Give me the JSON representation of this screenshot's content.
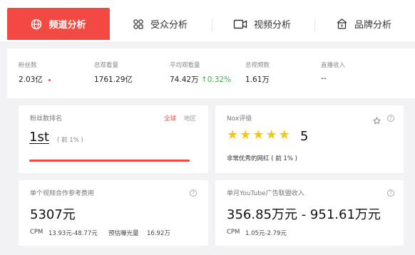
{
  "tabs": [
    {
      "label": "频道分析",
      "icon": "globe-icon",
      "active": true
    },
    {
      "label": "受众分析",
      "icon": "audience-icon",
      "active": false
    },
    {
      "label": "视频分析",
      "icon": "video-icon",
      "active": false
    },
    {
      "label": "品牌分析",
      "icon": "brand-icon",
      "active": false
    }
  ],
  "stats": {
    "subscribers": {
      "label": "粉丝数",
      "value": "2.03亿"
    },
    "total_views": {
      "label": "总观看量",
      "value": "1761.29亿"
    },
    "avg_views": {
      "label": "平均观看量",
      "value": "74.42万",
      "change": "0.32%"
    },
    "total_videos": {
      "label": "总视频数",
      "value": "1.61万"
    },
    "live_income": {
      "label": "直播收入",
      "value": "--"
    }
  },
  "rank_card": {
    "title": "粉丝数排名",
    "filter_global": "全球",
    "filter_region": "地区",
    "rank": "1st",
    "percent": "( 前 1% )",
    "accent_color": "#f24a43"
  },
  "nox_card": {
    "title": "Nox评级",
    "score": "5",
    "stars": 5,
    "desc": "非常优秀的网红 ( 前 1% )",
    "star_color": "#f5c518"
  },
  "cost_card": {
    "title": "单个视频合作参考费用",
    "value": "5307元",
    "cpm_label": "CPM",
    "cpm_value": "13.93元-48.77元",
    "exposure_label": "预估曝光量",
    "exposure_value": "16.92万"
  },
  "ad_card": {
    "title": "单月YouTube广告联盟收入",
    "value": "356.85万元 - 951.61万元",
    "cpm_label": "CPM",
    "cpm_value": "1.05元-2.79元"
  },
  "help_glyph": "?"
}
